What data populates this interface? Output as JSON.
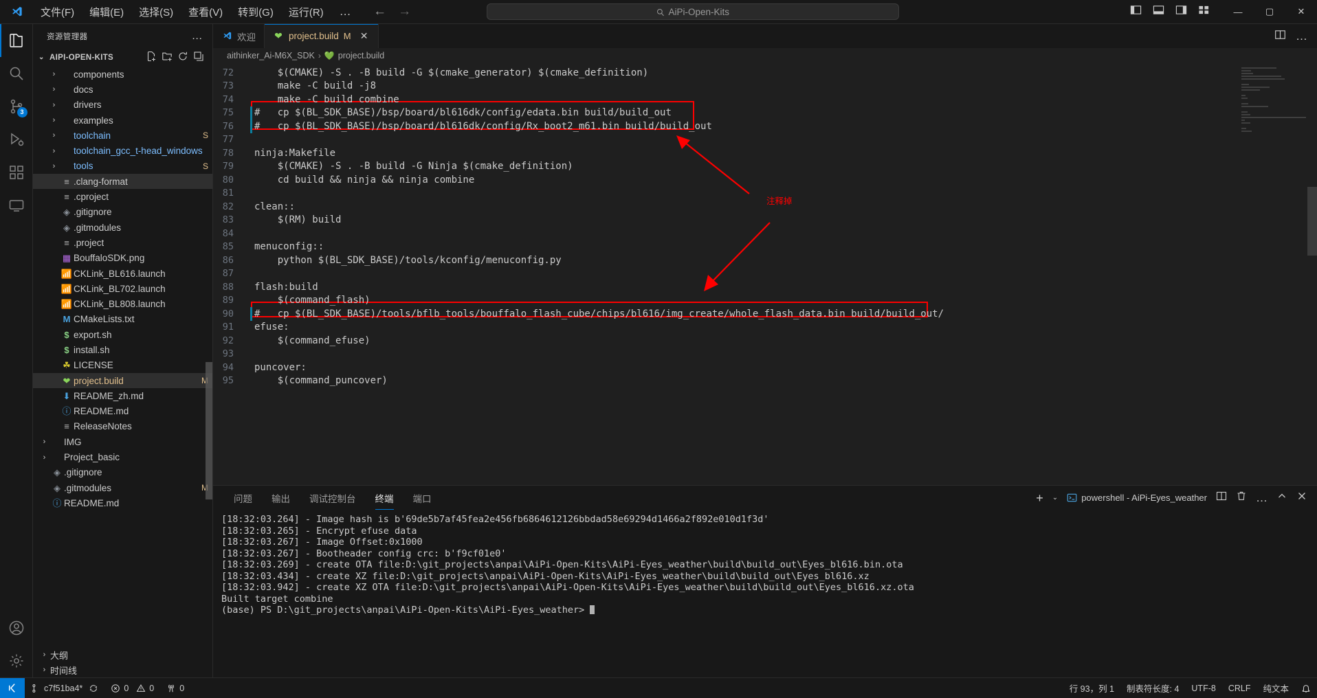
{
  "titlebar": {
    "menu": [
      "文件(F)",
      "编辑(E)",
      "选择(S)",
      "查看(V)",
      "转到(G)",
      "运行(R)"
    ],
    "more": "…",
    "back_icon": "arrow-left-icon",
    "forward_icon": "arrow-right-icon",
    "search_value": "AiPi-Open-Kits",
    "search_icon": "search-icon",
    "minimize": "—",
    "maximize": "▢",
    "close": "✕"
  },
  "activitybar": {
    "items": [
      {
        "name": "explorer",
        "icon": "files-icon",
        "badge": "",
        "active": true
      },
      {
        "name": "search",
        "icon": "search-icon",
        "badge": "",
        "active": false
      },
      {
        "name": "source-control",
        "icon": "source-control-icon",
        "badge": "3",
        "active": false
      },
      {
        "name": "run-and-debug",
        "icon": "debug-icon",
        "badge": "",
        "active": false
      },
      {
        "name": "extensions",
        "icon": "extensions-icon",
        "badge": "",
        "active": false
      },
      {
        "name": "remote-explorer",
        "icon": "remote-icon",
        "badge": "",
        "active": false
      }
    ],
    "bottom": [
      {
        "name": "accounts",
        "icon": "account-icon"
      },
      {
        "name": "settings",
        "icon": "gear-icon"
      }
    ]
  },
  "sidebar": {
    "title": "资源管理器",
    "more_icon": "…",
    "section": {
      "label": "AIPI-OPEN-KITS",
      "caret": "⌄",
      "actions": [
        "new-file-icon",
        "new-folder-icon",
        "refresh-icon",
        "collapse-all-icon"
      ]
    },
    "tree": [
      {
        "name": "components",
        "type": "folder",
        "twist": "›",
        "color": "normal",
        "git": ""
      },
      {
        "name": "docs",
        "type": "folder",
        "twist": "›",
        "color": "normal",
        "git": ""
      },
      {
        "name": "drivers",
        "type": "folder",
        "twist": "›",
        "color": "normal",
        "git": ""
      },
      {
        "name": "examples",
        "type": "folder",
        "twist": "›",
        "color": "normal",
        "git": ""
      },
      {
        "name": "toolchain",
        "type": "folder",
        "twist": "›",
        "color": "blue",
        "git": "S"
      },
      {
        "name": "toolchain_gcc_t-head_windows",
        "type": "folder",
        "twist": "›",
        "color": "blue",
        "git": ""
      },
      {
        "name": "tools",
        "type": "folder",
        "twist": "›",
        "color": "blue",
        "git": "S"
      },
      {
        "name": ".clang-format",
        "type": "settings",
        "twist": "",
        "color": "normal",
        "git": "",
        "selected": true
      },
      {
        "name": ".cproject",
        "type": "settings",
        "twist": "",
        "color": "normal",
        "git": ""
      },
      {
        "name": ".gitignore",
        "type": "git",
        "twist": "",
        "color": "normal",
        "git": ""
      },
      {
        "name": ".gitmodules",
        "type": "git",
        "twist": "",
        "color": "normal",
        "git": ""
      },
      {
        "name": ".project",
        "type": "settings",
        "twist": "",
        "color": "normal",
        "git": ""
      },
      {
        "name": "BouffaloSDK.png",
        "type": "image",
        "twist": "",
        "color": "normal",
        "git": ""
      },
      {
        "name": "CKLink_BL616.launch",
        "type": "launch",
        "twist": "",
        "color": "normal",
        "git": ""
      },
      {
        "name": "CKLink_BL702.launch",
        "type": "launch",
        "twist": "",
        "color": "normal",
        "git": ""
      },
      {
        "name": "CKLink_BL808.launch",
        "type": "launch",
        "twist": "",
        "color": "normal",
        "git": ""
      },
      {
        "name": "CMakeLists.txt",
        "type": "cmake",
        "twist": "",
        "color": "normal",
        "git": ""
      },
      {
        "name": "export.sh",
        "type": "shell",
        "twist": "",
        "color": "normal",
        "git": ""
      },
      {
        "name": "install.sh",
        "type": "shell",
        "twist": "",
        "color": "normal",
        "git": ""
      },
      {
        "name": "LICENSE",
        "type": "license",
        "twist": "",
        "color": "normal",
        "git": ""
      },
      {
        "name": "project.build",
        "type": "build",
        "twist": "",
        "color": "orange",
        "git": "M",
        "selected": true
      },
      {
        "name": "README_zh.md",
        "type": "md-down",
        "twist": "",
        "color": "normal",
        "git": ""
      },
      {
        "name": "README.md",
        "type": "md-info",
        "twist": "",
        "color": "normal",
        "git": ""
      },
      {
        "name": "ReleaseNotes",
        "type": "settings",
        "twist": "",
        "color": "normal",
        "git": ""
      },
      {
        "name": "IMG",
        "type": "folder",
        "twist": "›",
        "color": "normal",
        "git": "",
        "root": true
      },
      {
        "name": "Project_basic",
        "type": "folder",
        "twist": "›",
        "color": "normal",
        "git": "",
        "root": true
      },
      {
        "name": ".gitignore",
        "type": "git",
        "twist": "",
        "color": "normal",
        "git": "",
        "root": true
      },
      {
        "name": ".gitmodules",
        "type": "git",
        "twist": "",
        "color": "normal",
        "git": "M",
        "root": true
      },
      {
        "name": "README.md",
        "type": "md-info",
        "twist": "",
        "color": "normal",
        "git": "",
        "root": true
      }
    ],
    "footers": [
      {
        "label": "大纲",
        "caret": "›"
      },
      {
        "label": "时间线",
        "caret": "›"
      }
    ]
  },
  "editor": {
    "tabs": [
      {
        "label": "欢迎",
        "icon": "vscode-icon",
        "modified": "",
        "active": false,
        "closable": false
      },
      {
        "label": "project.build",
        "icon": "build-heart-icon",
        "modified": "M",
        "active": true,
        "closable": true
      }
    ],
    "tabs_actions": [
      "split-editor-icon",
      "more-actions-icon"
    ],
    "breadcrumb": [
      {
        "label": "aithinker_Ai-M6X_SDK",
        "icon": ""
      },
      {
        "label": "project.build",
        "icon": "build-heart-icon"
      }
    ],
    "first_line": 72,
    "lines": [
      {
        "n": 72,
        "text": "    $(CMAKE) -S . -B build -G $(cmake_generator) $(cmake_definition)",
        "modified": false,
        "comment": false
      },
      {
        "n": 73,
        "text": "    make -C build -j8",
        "modified": false,
        "comment": false
      },
      {
        "n": 74,
        "text": "    make -C build combine",
        "modified": false,
        "comment": false
      },
      {
        "n": 75,
        "text": "#   cp $(BL_SDK_BASE)/bsp/board/bl616dk/config/edata.bin build/build_out",
        "modified": true,
        "comment": false
      },
      {
        "n": 76,
        "text": "#   cp $(BL_SDK_BASE)/bsp/board/bl616dk/config/Rx_boot2_m61.bin build/build_out",
        "modified": true,
        "comment": false
      },
      {
        "n": 77,
        "text": "",
        "modified": false,
        "comment": false
      },
      {
        "n": 78,
        "text": "ninja:Makefile",
        "modified": false,
        "comment": false
      },
      {
        "n": 79,
        "text": "    $(CMAKE) -S . -B build -G Ninja $(cmake_definition)",
        "modified": false,
        "comment": false
      },
      {
        "n": 80,
        "text": "    cd build && ninja && ninja combine",
        "modified": false,
        "comment": false
      },
      {
        "n": 81,
        "text": "",
        "modified": false,
        "comment": false
      },
      {
        "n": 82,
        "text": "clean::",
        "modified": false,
        "comment": false
      },
      {
        "n": 83,
        "text": "    $(RM) build",
        "modified": false,
        "comment": false
      },
      {
        "n": 84,
        "text": "",
        "modified": false,
        "comment": false
      },
      {
        "n": 85,
        "text": "menuconfig::",
        "modified": false,
        "comment": false
      },
      {
        "n": 86,
        "text": "    python $(BL_SDK_BASE)/tools/kconfig/menuconfig.py",
        "modified": false,
        "comment": false
      },
      {
        "n": 87,
        "text": "",
        "modified": false,
        "comment": false
      },
      {
        "n": 88,
        "text": "flash:build",
        "modified": false,
        "comment": false
      },
      {
        "n": 89,
        "text": "    $(command_flash)",
        "modified": false,
        "comment": false
      },
      {
        "n": 90,
        "text": "#   cp $(BL_SDK_BASE)/tools/bflb_tools/bouffalo_flash_cube/chips/bl616/img_create/whole_flash_data.bin build/build_out/",
        "modified": true,
        "comment": false
      },
      {
        "n": 91,
        "text": "efuse:",
        "modified": false,
        "comment": false
      },
      {
        "n": 92,
        "text": "    $(command_efuse)",
        "modified": false,
        "comment": false
      },
      {
        "n": 93,
        "text": "",
        "modified": false,
        "comment": false
      },
      {
        "n": 94,
        "text": "puncover:",
        "modified": false,
        "comment": false
      },
      {
        "n": 95,
        "text": "    $(command_puncover)",
        "modified": false,
        "comment": false
      }
    ],
    "annotation": "注释掉"
  },
  "panel": {
    "tabs": [
      {
        "label": "问题",
        "active": false
      },
      {
        "label": "输出",
        "active": false
      },
      {
        "label": "调试控制台",
        "active": false
      },
      {
        "label": "终端",
        "active": true
      },
      {
        "label": "端口",
        "active": false
      }
    ],
    "new_terminal": "+",
    "dropdown": "⌄",
    "terminal_name": "powershell - AiPi-Eyes_weather",
    "actions": [
      "split-terminal-icon",
      "kill-terminal-icon",
      "more-actions-icon",
      "maximize-panel-icon",
      "close-panel-icon"
    ],
    "terminal_lines": [
      "[18:32:03.264] - Image hash is b'69de5b7af45fea2e456fb6864612126bbdad58e69294d1466a2f892e010d1f3d'",
      "[18:32:03.265] - Encrypt efuse data",
      "[18:32:03.267] - Image Offset:0x1000",
      "[18:32:03.267] - Bootheader config crc: b'f9cf01e0'",
      "[18:32:03.269] - create OTA file:D:\\git_projects\\anpai\\AiPi-Open-Kits\\AiPi-Eyes_weather\\build\\build_out\\Eyes_bl616.bin.ota",
      "[18:32:03.434] - create XZ file:D:\\git_projects\\anpai\\AiPi-Open-Kits\\AiPi-Eyes_weather\\build\\build_out\\Eyes_bl616.xz",
      "[18:32:03.942] - create XZ OTA file:D:\\git_projects\\anpai\\AiPi-Open-Kits\\AiPi-Eyes_weather\\build\\build_out\\Eyes_bl616.xz.ota",
      "Built target combine",
      "(base) PS D:\\git_projects\\anpai\\AiPi-Open-Kits\\AiPi-Eyes_weather> "
    ]
  },
  "statusbar": {
    "remote_icon": "remote-window-icon",
    "branch": "c7f51ba4*",
    "branch_icon": "source-control-icon",
    "sync_icon": "sync-icon",
    "errors": "0",
    "warnings": "0",
    "ports": "0",
    "error_icon": "error-icon",
    "warning_icon": "warning-icon",
    "ports_icon": "radio-tower-icon",
    "cursor_position": "行 93，列 1",
    "indent": "制表符长度: 4",
    "encoding": "UTF-8",
    "eol": "CRLF",
    "language": "纯文本",
    "bell_icon": "bell-icon"
  },
  "colors": {
    "accent": "#0078d4",
    "annotation_red": "#ff0000",
    "modified_orange": "#e2c08d",
    "bg": "#1f1f1f",
    "chrome": "#181818"
  }
}
